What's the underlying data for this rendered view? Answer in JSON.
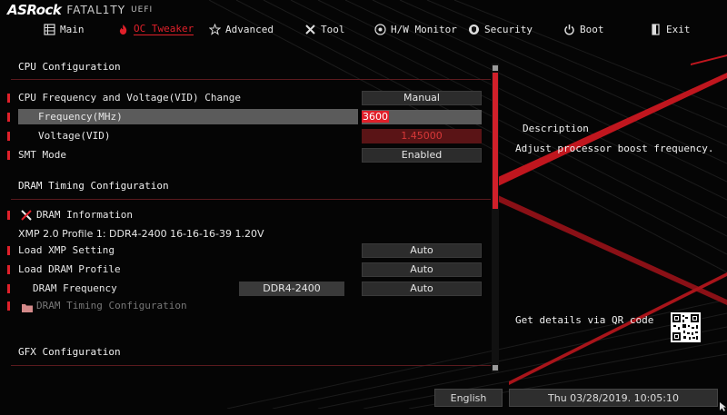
{
  "header": {
    "brand": "ASRock",
    "series": "FATAL1TY",
    "product": "UEFI"
  },
  "nav": {
    "tabs": [
      {
        "id": "main",
        "label": "Main",
        "icon": "grid-icon",
        "active": false
      },
      {
        "id": "oc",
        "label": "OC Tweaker",
        "icon": "flame-icon",
        "active": true
      },
      {
        "id": "advanced",
        "label": "Advanced",
        "icon": "star-icon",
        "active": false
      },
      {
        "id": "tool",
        "label": "Tool",
        "icon": "tools-icon",
        "active": false
      },
      {
        "id": "hwmon",
        "label": "H/W Monitor",
        "icon": "monitor-icon",
        "active": false
      },
      {
        "id": "security",
        "label": "Security",
        "icon": "shield-icon",
        "active": false
      },
      {
        "id": "boot",
        "label": "Boot",
        "icon": "power-icon",
        "active": false
      },
      {
        "id": "exit",
        "label": "Exit",
        "icon": "exit-icon",
        "active": false
      }
    ]
  },
  "content": {
    "cpu_config_title": "CPU Configuration",
    "cpu_freq_voltage": {
      "label": "CPU Frequency and Voltage(VID) Change",
      "value": "Manual"
    },
    "frequency": {
      "label": "Frequency(MHz)",
      "value": "3600"
    },
    "voltage": {
      "label": "Voltage(VID)",
      "value": "1.45000"
    },
    "smt_mode": {
      "label": "SMT Mode",
      "value": "Enabled"
    },
    "dram_timing_title": "DRAM Timing Configuration",
    "dram_information": "DRAM Information",
    "xmp_profile": "XMP 2.0 Profile 1: DDR4-2400 16-16-16-39 1.20V",
    "load_xmp": {
      "label": "Load XMP Setting",
      "value": "Auto"
    },
    "load_dram_profile": {
      "label": "Load DRAM Profile",
      "value": "Auto"
    },
    "dram_frequency": {
      "label": "DRAM Frequency",
      "current": "DDR4-2400",
      "value": "Auto"
    },
    "dram_timing_config": "DRAM Timing Configuration",
    "gfx_config_title": "GFX Configuration"
  },
  "description": {
    "title": "Description",
    "text": "Adjust processor boost frequency."
  },
  "qr": {
    "text": "Get details via QR code"
  },
  "footer": {
    "language": "English",
    "datetime": "Thu 03/28/2019. 10:05:10"
  },
  "colors": {
    "accent": "#e0202a",
    "background": "#050505",
    "field": "#2c2c2c",
    "highlight": "#5b5b5b"
  }
}
